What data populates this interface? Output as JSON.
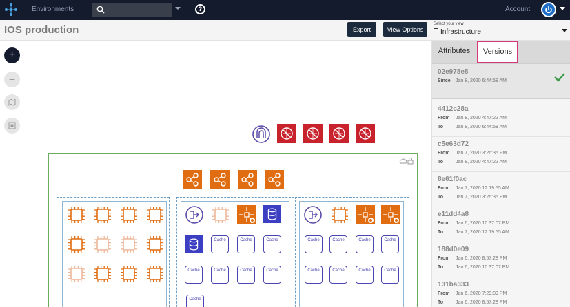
{
  "nav": {
    "environments": "Environments",
    "search_placeholder": "",
    "account": "Account"
  },
  "title": {
    "page_title": "IOS production",
    "export_label": "Export",
    "view_options_label": "View Options",
    "select_view_label": "Select your view",
    "selected_view": "Infrastructure"
  },
  "tools": {
    "add": "+",
    "minus": "–"
  },
  "colors": {
    "nav_bg": "#141b2d",
    "accent_orange": "#e06d12",
    "accent_red": "#c8222c",
    "cache_border": "#4a47b0",
    "vpc_green": "#6bab5e",
    "tab_highlight": "#d43a7b",
    "check_green": "#3a9a4a"
  },
  "canvas": {
    "cache_label": "Cache"
  },
  "panel": {
    "tabs": [
      "Attributes",
      "Versions"
    ],
    "since_label": "Since",
    "from_label": "From",
    "to_label": "To",
    "versions": [
      {
        "id": "02e978e8",
        "since": "Jan 8, 2020 6:44:58 AM"
      },
      {
        "id": "4412c28a",
        "from": "Jan 8, 2020 4:47:22 AM",
        "to": "Jan 8, 2020 6:44:58 AM"
      },
      {
        "id": "c5e63d72",
        "from": "Jan 7, 2020 3:26:35 PM",
        "to": "Jan 8, 2020 4:47:22 AM"
      },
      {
        "id": "8e61f0ac",
        "from": "Jan 7, 2020 12:19:55 AM",
        "to": "Jan 7, 2020 3:26:35 PM"
      },
      {
        "id": "e11dd4a8",
        "from": "Jan 6, 2020 10:37:07 PM",
        "to": "Jan 7, 2020 12:19:55 AM"
      },
      {
        "id": "188d0e09",
        "from": "Jan 6, 2020 8:57:28 PM",
        "to": "Jan 6, 2020 10:37:07 PM"
      },
      {
        "id": "131ba333",
        "from": "Jan 6, 2020 7:29:09 PM",
        "to": "Jan 6, 2020 8:57:28 PM"
      }
    ]
  }
}
